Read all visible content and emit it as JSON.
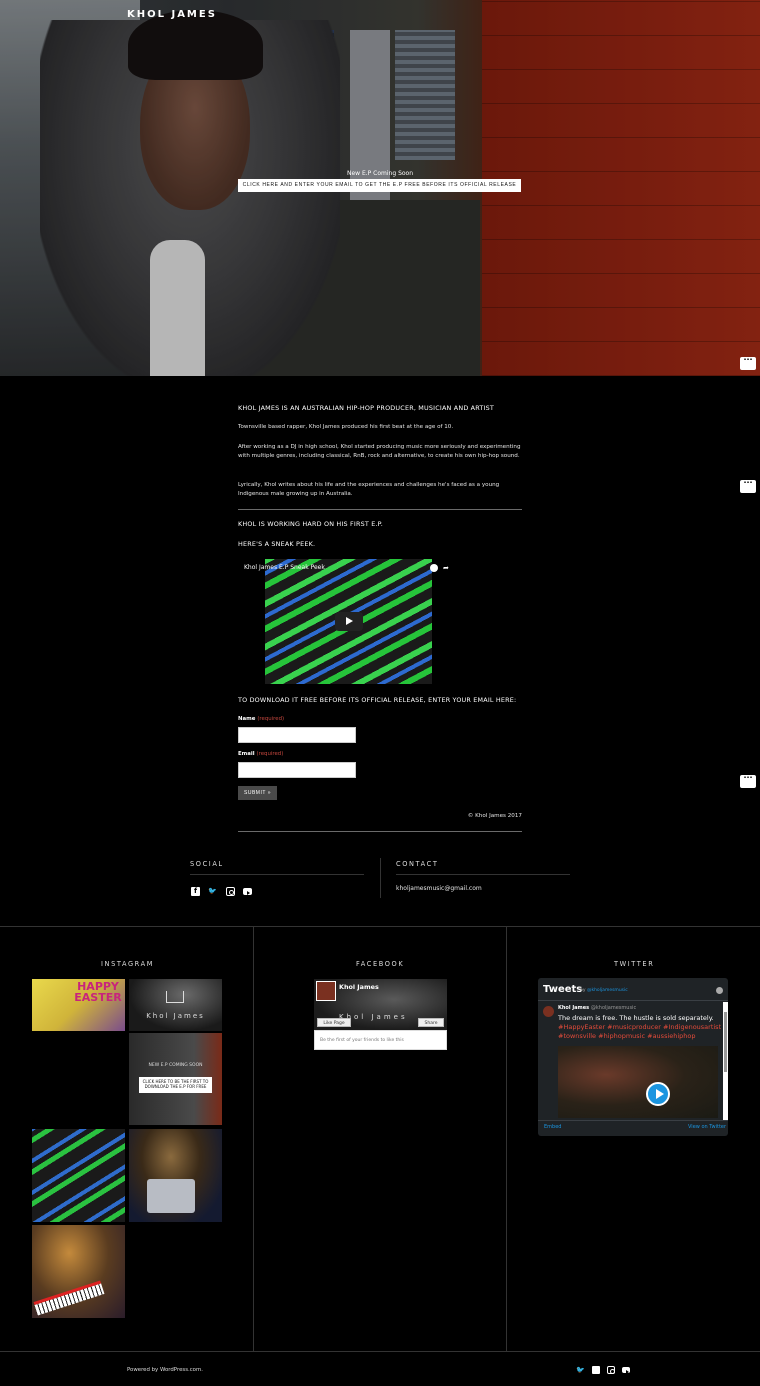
{
  "site": {
    "title": "KHOL JAMES"
  },
  "hero": {
    "cta_title": "New E.P Coming Soon",
    "cta_button": "CLICK HERE AND ENTER YOUR EMAIL TO GET THE E.P FREE BEFORE ITS OFFICIAL RELEASE"
  },
  "edit_dots": "···",
  "about": {
    "heading": "KHOL JAMES IS AN AUSTRALIAN HIP-HOP PRODUCER, MUSICIAN AND ARTIST",
    "p1": "Townsville based rapper, Khol James produced his first beat at the age of 10.",
    "p2": "After working as a DJ in high school, Khol started producing music more seriously and experimenting with multiple genres, including classical, RnB, rock and alternative, to create his own hip-hop sound.",
    "p3": "Lyrically, Khol writes about his life and the experiences and challenges he's faced as a young Indigenous male growing up in Australia.",
    "ep_heading": "KHOL IS WORKING HARD ON HIS FIRST E.P.",
    "peek_heading": "HERE'S A SNEAK PEEK.",
    "video_title": "Khol James E.P Sneak Peek",
    "download_heading": "TO DOWNLOAD IT FREE BEFORE ITS OFFICIAL RELEASE, ENTER YOUR EMAIL HERE:"
  },
  "form": {
    "name_label": "Name",
    "email_label": "Email",
    "required": "(required)",
    "submit": "SUBMIT »"
  },
  "copyright": "© Khol James 2017",
  "social": {
    "title": "SOCIAL"
  },
  "contact": {
    "title": "CONTACT",
    "email": "kholjamesmusic@gmail.com"
  },
  "instagram": {
    "title": "INSTAGRAM",
    "tile1_text": "HAPPY EASTER",
    "tile2_text": "Khol James",
    "tile3_title": "NEW E.P COMING SOON",
    "tile3_button": "CLICK HERE TO BE THE FIRST TO DOWNLOAD THE E.P FOR FREE"
  },
  "facebook": {
    "title": "FACEBOOK",
    "page_name": "Khol James",
    "brand": "Khol James",
    "like": "Like Page",
    "share": "Share",
    "footer": "Be the first of your friends to like this"
  },
  "twitter": {
    "title": "TWITTER",
    "header": "Tweets",
    "by": "by",
    "handle": "@kholjamesmusic",
    "author": "Khol James",
    "author_handle": "@kholjamesmusic",
    "text": "The dream is free. The hustle is sold separately.",
    "tags": "#HappyEaster #musicproducer #Indigenousartist #townsville #hiphopmusic #aussiehiphop",
    "embed": "Embed",
    "view": "View on Twitter"
  },
  "footer": {
    "powered": "Powered by WordPress.com."
  }
}
